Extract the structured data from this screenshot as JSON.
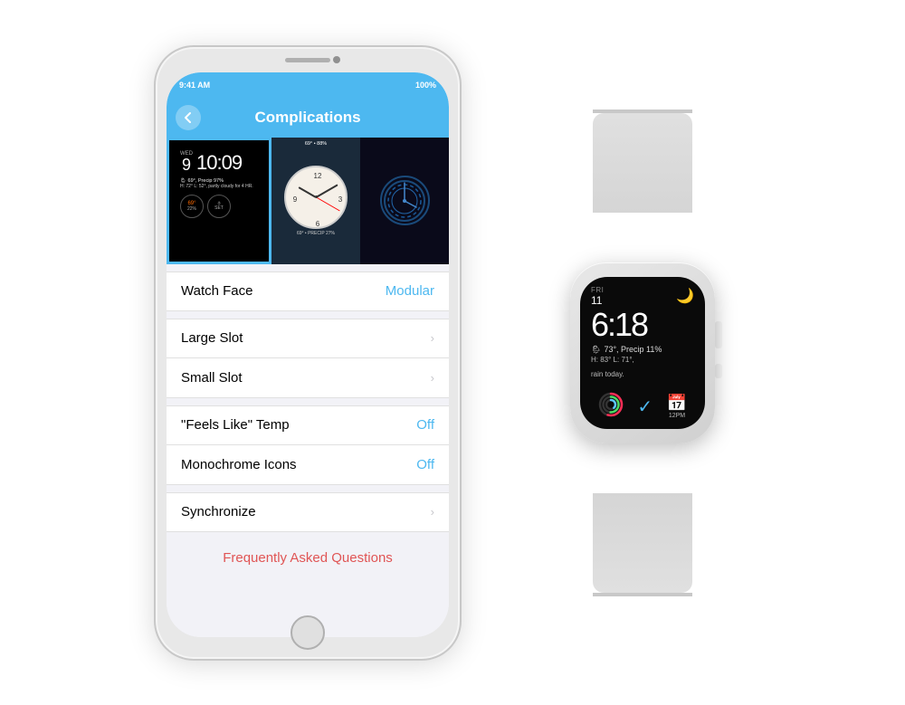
{
  "scene": {
    "background": "#ffffff"
  },
  "iphone": {
    "statusBar": {
      "left": "9:41 AM",
      "right": "100%"
    },
    "navBar": {
      "title": "Complications",
      "backLabel": "←"
    },
    "watchFaces": [
      {
        "id": "modular",
        "selected": true
      },
      {
        "id": "analog",
        "selected": false
      },
      {
        "id": "dark",
        "selected": false
      }
    ],
    "modularFace": {
      "day": "WED",
      "date": "9",
      "time": "10:09",
      "weatherLine": "🌦 69°, Precip 97%",
      "weatherSub": "H: 72° L: 52°, partly cloudy for 4 HR.",
      "comp1val": "69°",
      "comp1label": "22%",
      "comp2label": "SET"
    },
    "analogFace": {
      "tempTop": "69° • 88%",
      "weatherBottom": "69° • PRECIP 27%"
    },
    "rows": [
      {
        "label": "Watch Face",
        "value": "Modular",
        "hasChevron": false,
        "valueColor": "#4db8f0"
      },
      {
        "label": "Large Slot",
        "value": "",
        "hasChevron": true
      },
      {
        "label": "Small Slot",
        "value": "",
        "hasChevron": true
      },
      {
        "label": "\"Feels Like\" Temp",
        "value": "Off",
        "hasChevron": false,
        "valueColor": "#4db8f0"
      },
      {
        "label": "Monochrome Icons",
        "value": "Off",
        "hasChevron": false,
        "valueColor": "#4db8f0"
      },
      {
        "label": "Synchronize",
        "value": "",
        "hasChevron": true
      }
    ],
    "faq": {
      "label": "Frequently Asked Questions",
      "color": "#e05555"
    }
  },
  "appleWatch": {
    "screen": {
      "day": "FRI",
      "date": "11",
      "time": "6:18",
      "weatherMain": "🌦 73°, Precip 11%",
      "weatherSub1": "H: 83° L: 71°,",
      "weatherSub2": "rain today.",
      "comp1": "activity",
      "comp2": "checkmark",
      "comp3": "calendar",
      "calLabel": "12PM"
    }
  }
}
